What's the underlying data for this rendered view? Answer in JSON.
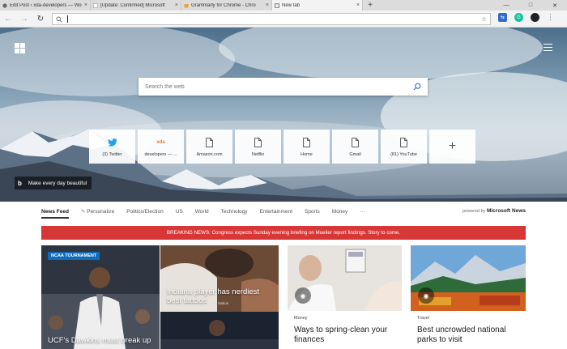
{
  "tabs": [
    {
      "title": "Edit Post ‹ xda-developers — Wo",
      "active": false
    },
    {
      "title": "[Update: Confirmed] Microsoft",
      "active": false
    },
    {
      "title": "Grammarly for Chrome - Chro",
      "active": false
    },
    {
      "title": "New tab",
      "active": true
    }
  ],
  "toolbar": {
    "back": "←",
    "forward": "→",
    "refresh": "↻",
    "address_value": "",
    "star": "☆"
  },
  "window_controls": {
    "minimize": "—",
    "maximize": "□",
    "close": "✕"
  },
  "hero": {
    "search_placeholder": "Search the web",
    "bing_caption": "Make every day beautiful",
    "bing_logo": "b"
  },
  "tiles": [
    {
      "label": "(3) Twitter",
      "icon": "twitter-icon"
    },
    {
      "label": "developers — ...",
      "icon": "xda-icon"
    },
    {
      "label": "Amazon.com",
      "icon": "page-icon"
    },
    {
      "label": "Netflix",
      "icon": "page-icon"
    },
    {
      "label": "Home",
      "icon": "page-icon"
    },
    {
      "label": "Gmail",
      "icon": "page-icon"
    },
    {
      "label": "(81) YouTube",
      "icon": "page-icon"
    }
  ],
  "tile_add": "+",
  "news_nav": {
    "items": [
      "News Feed",
      "Personalize",
      "Politics/Election",
      "US",
      "World",
      "Technology",
      "Entertainment",
      "Sports",
      "Money",
      "···"
    ],
    "powered_prefix": "powered by",
    "powered_brand": "Microsoft News"
  },
  "breaking": "BREAKING NEWS: Congress expects Sunday evening briefing on Mueller report findings. Story to come.",
  "cards": {
    "c1": {
      "badge": "NCAA TOURNAMENT",
      "headline": "UCF's Dawkins must break up"
    },
    "c2": {
      "headline": "Indiana player has nerdiest best tattoos",
      "source": "SB Nation"
    },
    "c4": {
      "category": "Money",
      "headline": "Ways to spring-clean your finances"
    },
    "c5": {
      "category": "Travel",
      "headline": "Best uncrowded national parks to visit"
    }
  },
  "colors": {
    "accent": "#0f6cbd",
    "breaking": "#d83737",
    "twitter": "#1da1f2"
  }
}
